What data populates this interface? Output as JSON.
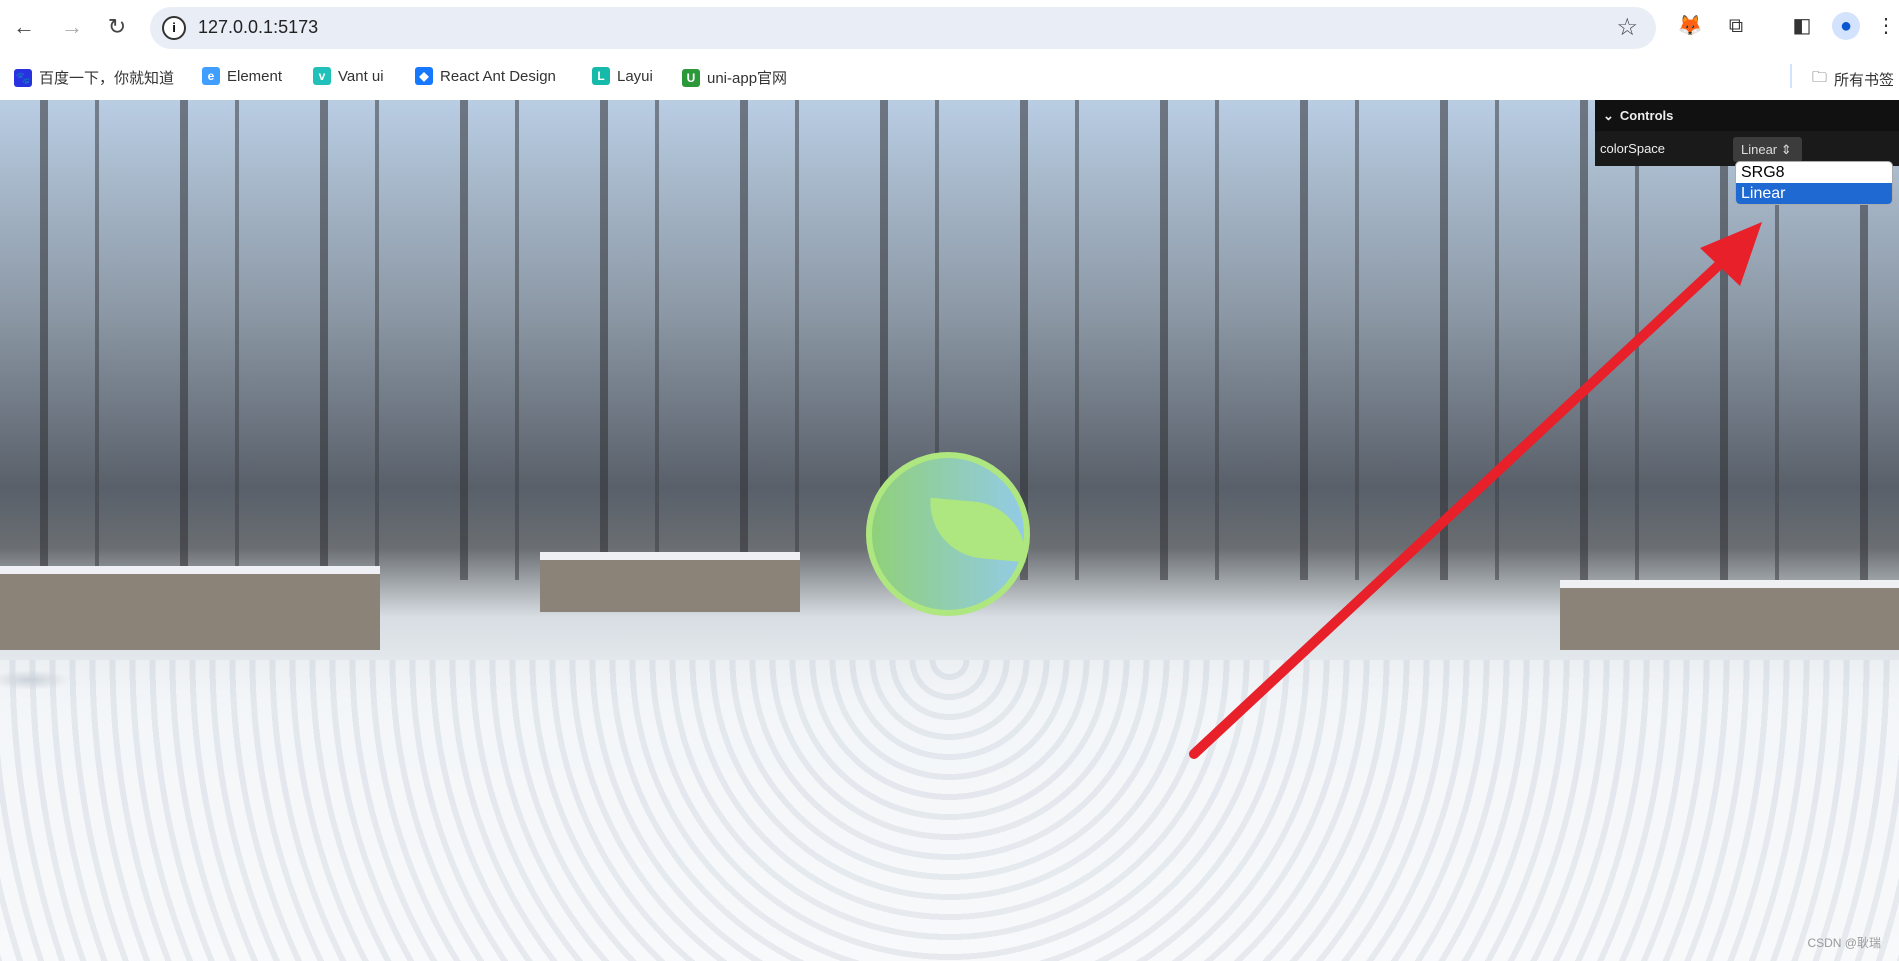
{
  "browser": {
    "url": "127.0.0.1:5173",
    "back": "←",
    "forward": "→",
    "reload": "↻",
    "star": "☆",
    "more": "⋮",
    "bookmarks": [
      {
        "label": "百度一下，你就知道",
        "icon": "baidu-paw-icon",
        "color": "#2932e1"
      },
      {
        "label": "Element",
        "icon": "element-icon",
        "color": "#409eff"
      },
      {
        "label": "Vant ui",
        "icon": "vant-icon",
        "color": "#1fc1b8"
      },
      {
        "label": "React Ant Design",
        "icon": "ant-design-icon",
        "color": "#1677ff"
      },
      {
        "label": "Layui",
        "icon": "layui-icon",
        "color": "#16baaa"
      },
      {
        "label": "uni-app官网",
        "icon": "uniapp-icon",
        "color": "#2b9939"
      }
    ],
    "all_bookmarks": "所有书签"
  },
  "controls": {
    "title": "Controls",
    "label": "colorSpace",
    "value": "Linear",
    "options": [
      "SRG8",
      "Linear"
    ],
    "selected": "Linear"
  },
  "annotation": {
    "arrow_color": "#e8202a"
  },
  "watermark": "CSDN @耿瑞"
}
